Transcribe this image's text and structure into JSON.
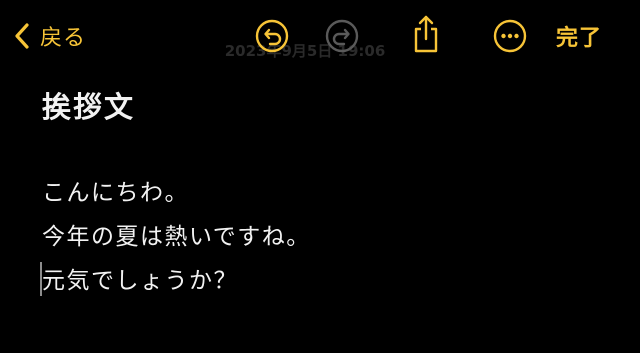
{
  "colors": {
    "accent": "#F7C437",
    "disabled": "#5a5a5a",
    "background": "#000000",
    "text": "#f2f2f2"
  },
  "toolbar": {
    "back_label": "戻る",
    "title": "2023年9月5日 19:06",
    "done_label": "完了",
    "icons": [
      "chevron-left-icon",
      "undo-icon",
      "redo-icon",
      "share-icon",
      "more-icon"
    ]
  },
  "note": {
    "title": "挨拶文",
    "lines": [
      "こんにちわ。",
      "今年の夏は熱いですね。",
      "元気でしょうか？"
    ]
  }
}
